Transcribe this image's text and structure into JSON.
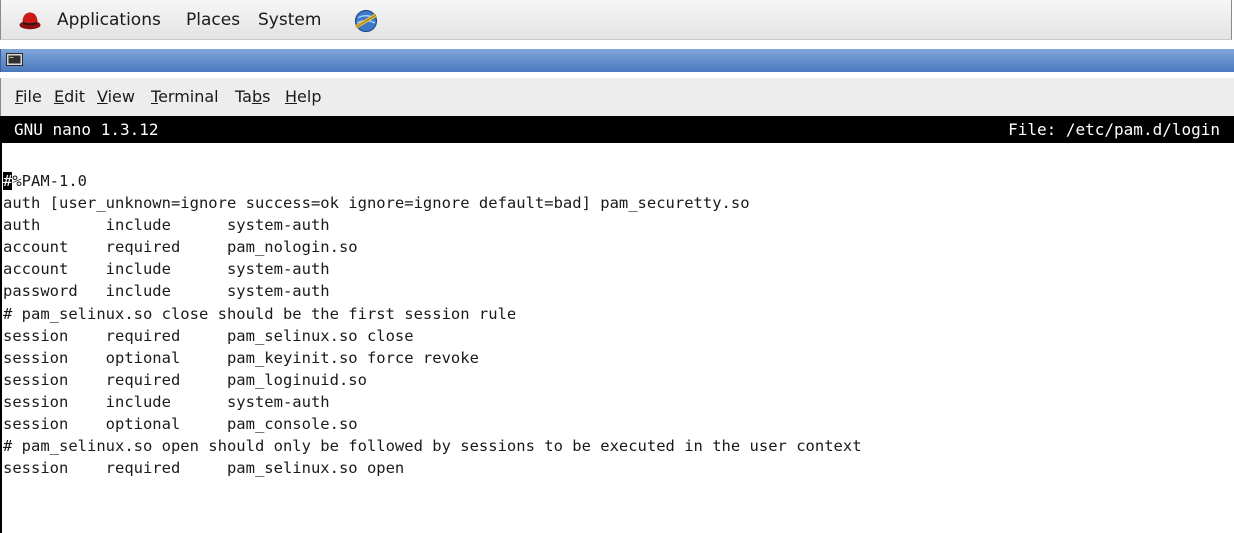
{
  "panel": {
    "applications_label": "Applications",
    "places_label": "Places",
    "system_label": "System"
  },
  "terminal": {
    "menu": {
      "file": {
        "mnemonic": "F",
        "rest": "ile"
      },
      "edit": {
        "mnemonic": "E",
        "rest": "dit"
      },
      "view": {
        "mnemonic": "V",
        "rest": "iew"
      },
      "terminal": {
        "mnemonic": "T",
        "rest": "erminal"
      },
      "tabs": {
        "pre": "Ta",
        "mnemonic": "b",
        "rest": "s"
      },
      "help": {
        "mnemonic": "H",
        "rest": "elp"
      }
    }
  },
  "nano": {
    "version": "GNU nano 1.3.12",
    "file": "File: /etc/pam.d/login",
    "cursor_char": "#",
    "first_line_rest": "%PAM-1.0",
    "lines": [
      "auth [user_unknown=ignore success=ok ignore=ignore default=bad] pam_securetty.so",
      "auth       include      system-auth",
      "account    required     pam_nologin.so",
      "account    include      system-auth",
      "password   include      system-auth",
      "# pam_selinux.so close should be the first session rule",
      "session    required     pam_selinux.so close",
      "session    optional     pam_keyinit.so force revoke",
      "session    required     pam_loginuid.so",
      "session    include      system-auth",
      "session    optional     pam_console.so",
      "# pam_selinux.so open should only be followed by sessions to be executed in the user context",
      "session    required     pam_selinux.so open"
    ]
  },
  "colors": {
    "titlebar": "#4a78bd",
    "nano_header_bg": "#000000",
    "nano_header_fg": "#ffffff",
    "editor_bg": "#ffffff"
  },
  "icons": {
    "applications": "redhat-icon",
    "system": "network-icon",
    "window": "terminal-window-icon"
  }
}
